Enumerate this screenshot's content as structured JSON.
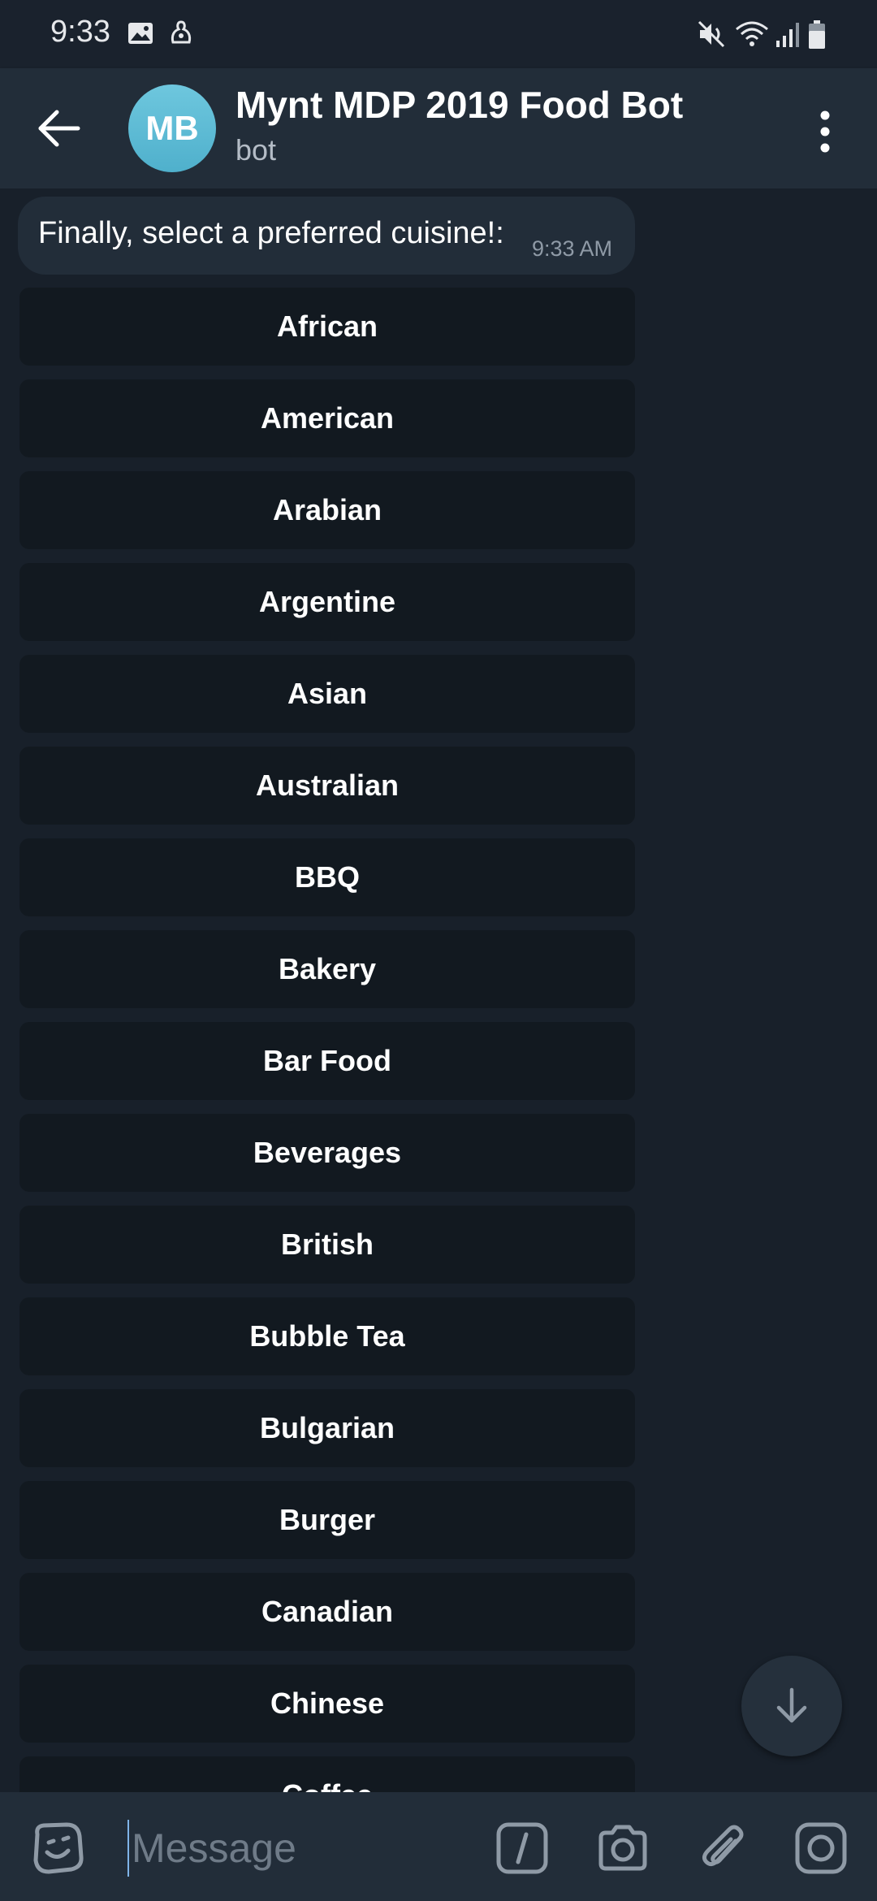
{
  "status_bar": {
    "time": "9:33",
    "left_icons": [
      "image-icon",
      "notification-icon"
    ],
    "right_icons": [
      "mute-icon",
      "wifi-icon",
      "signal-icon",
      "battery-icon"
    ]
  },
  "header": {
    "avatar_initials": "MB",
    "avatar_color": "#5bbad5",
    "title": "Mynt MDP 2019 Food Bot",
    "subtitle": "bot"
  },
  "message": {
    "text": "Finally, select a preferred cuisine!:",
    "time": "9:33 AM"
  },
  "keyboard": {
    "buttons": [
      "African",
      "American",
      "Arabian",
      "Argentine",
      "Asian",
      "Australian",
      "BBQ",
      "Bakery",
      "Bar Food",
      "Beverages",
      "British",
      "Bubble Tea",
      "Bulgarian",
      "Burger",
      "Canadian",
      "Chinese",
      "Coffee"
    ]
  },
  "input": {
    "placeholder": "Message"
  },
  "colors": {
    "background": "#18202a",
    "header": "#222d39",
    "keyboard_button": "#121920",
    "accent": "#5bbad5"
  }
}
